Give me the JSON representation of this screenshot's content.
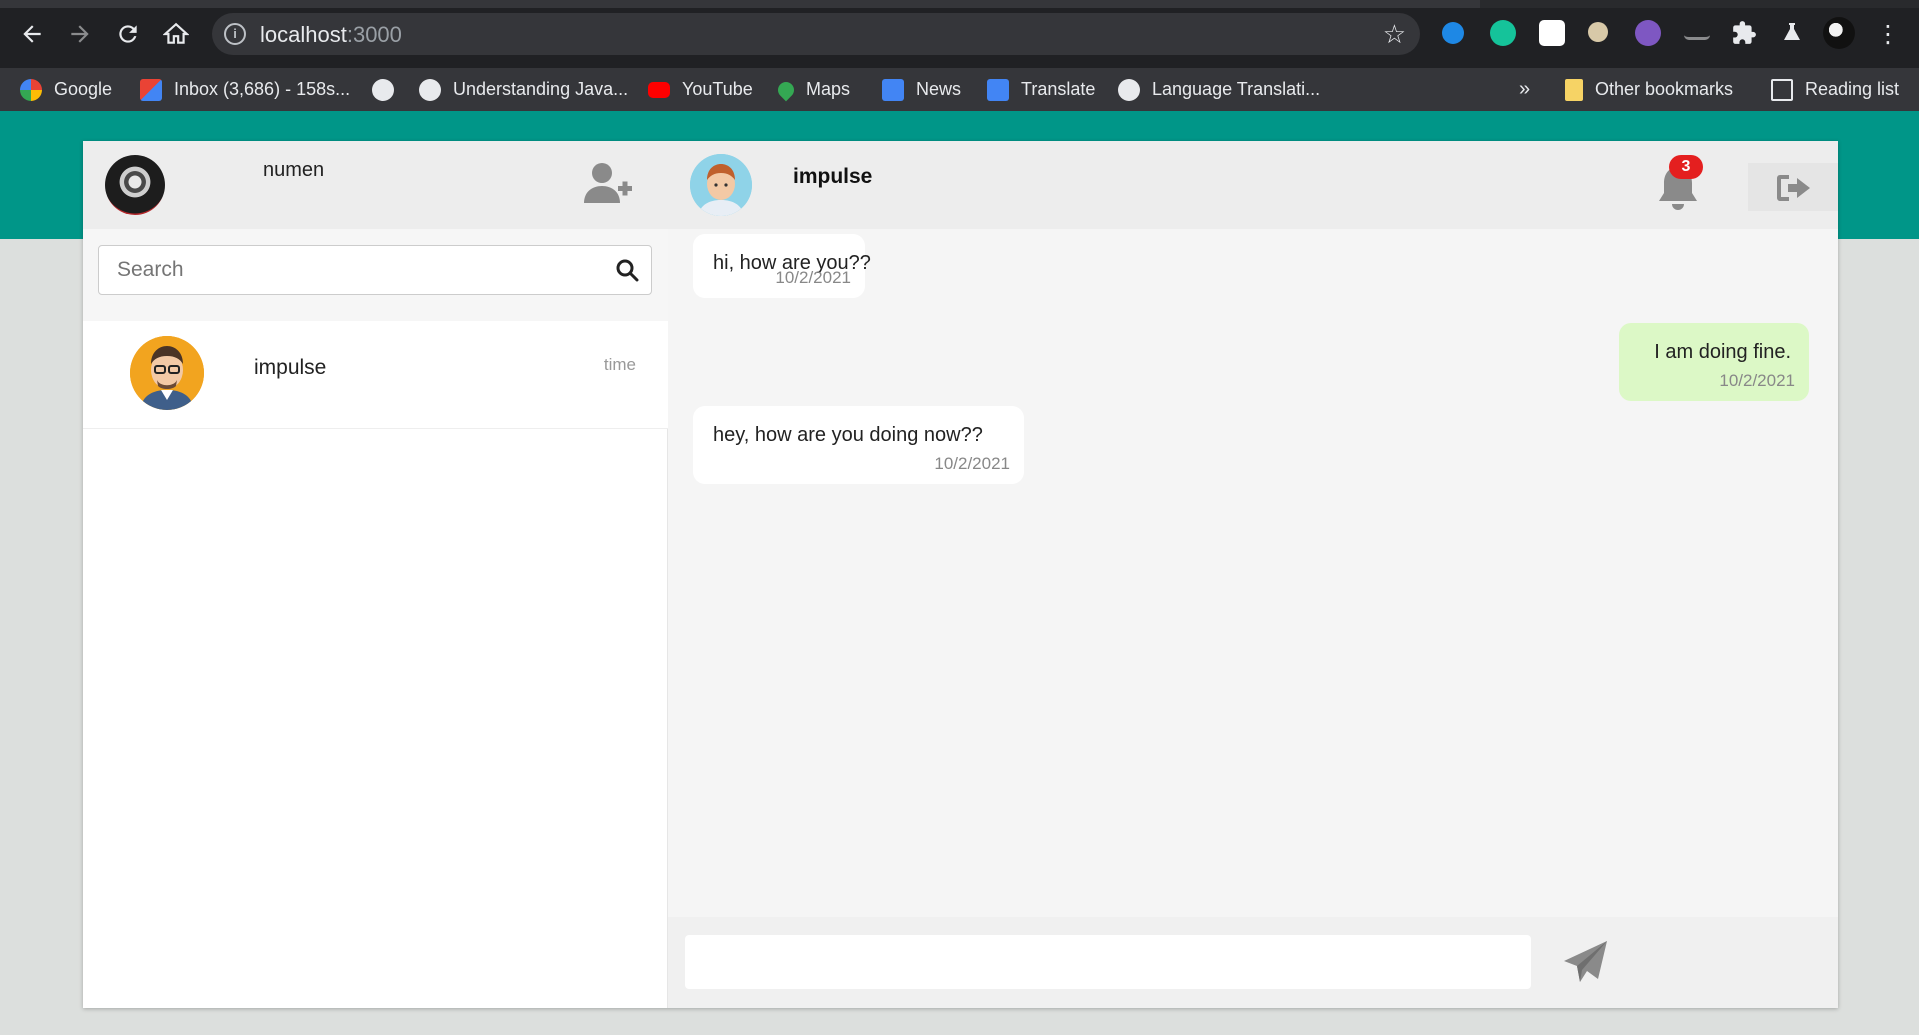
{
  "browser": {
    "url_host": "localhost",
    "url_port": ":3000",
    "bookmarks": [
      {
        "label": "Google",
        "color": "#4285f4"
      },
      {
        "label": "Inbox (3,686) - 158s...",
        "color": "#ea4335"
      },
      {
        "label": "",
        "color": "#e8eaed"
      },
      {
        "label": "Understanding Java...",
        "color": "#e8eaed"
      },
      {
        "label": "YouTube",
        "color": "#ff0000"
      },
      {
        "label": "Maps",
        "color": "#34a853"
      },
      {
        "label": "News",
        "color": "#4285f4"
      },
      {
        "label": "Translate",
        "color": "#4285f4"
      },
      {
        "label": "Language Translati...",
        "color": "#e8eaed"
      }
    ],
    "overflow_label": "»",
    "other_bookmarks": "Other bookmarks",
    "reading_list": "Reading list"
  },
  "app": {
    "accent": "#009688",
    "current_user": {
      "name": "numen"
    },
    "search": {
      "placeholder": "Search"
    },
    "contacts": [
      {
        "name": "impulse",
        "time": "time"
      }
    ],
    "chat": {
      "partner_name": "impulse",
      "notification_count": "3",
      "messages": [
        {
          "direction": "in",
          "text": "hi, how are you??",
          "date": "10/2/2021"
        },
        {
          "direction": "out",
          "text": "I am doing fine.",
          "date": "10/2/2021"
        },
        {
          "direction": "in",
          "text": "hey, how are you doing now??",
          "date": "10/2/2021"
        }
      ],
      "compose_placeholder": ""
    }
  }
}
